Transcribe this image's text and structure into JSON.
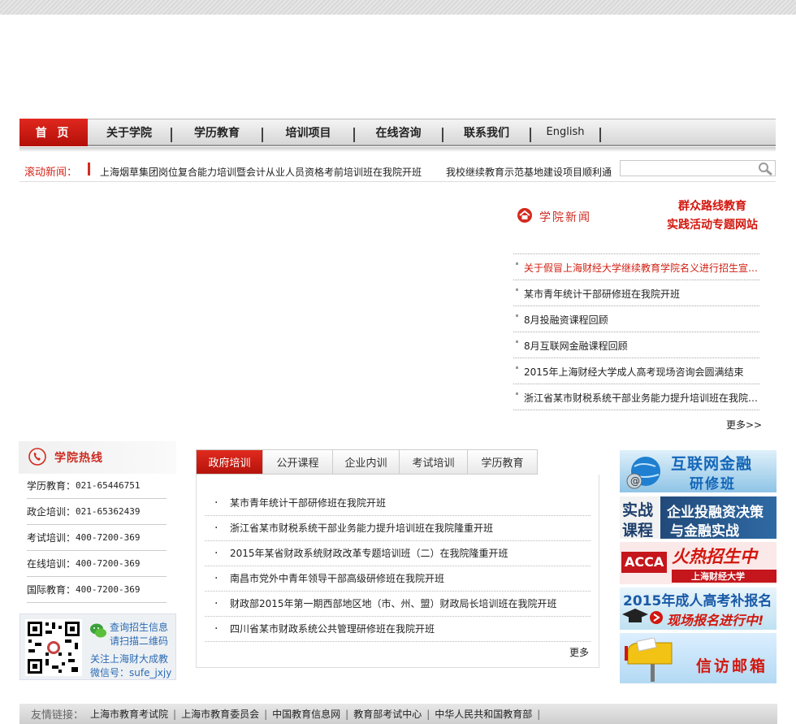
{
  "nav": {
    "items": [
      "首 页",
      "关于学院",
      "学历教育",
      "培训项目",
      "在线咨询",
      "联系我们",
      "English"
    ]
  },
  "ticker": {
    "label": "滚动新闻：",
    "items": [
      "上海烟草集团岗位复合能力培训暨会计从业人员资格考前培训班在我院开班",
      "我校继续教育示范基地建设项目顺利通"
    ]
  },
  "search": {
    "placeholder": ""
  },
  "college_news": {
    "title": "学院新闻",
    "promo": [
      "群众路线教育",
      "实践活动专题网站"
    ],
    "items": [
      "关于假冒上海财经大学继续教育学院名义进行招生宣传的声明",
      "某市青年统计干部研修班在我院开班",
      "8月投融资课程回顾",
      "8月互联网金融课程回顾",
      "2015年上海财经大学成人高考现场咨询会圆满结束",
      "浙江省某市财税系统干部业务能力提升培训班在我院隆重开班"
    ],
    "more": "更多>>"
  },
  "hotline": {
    "title": "学院热线",
    "rows": [
      {
        "label": "学历教育：",
        "number": "021-65446751"
      },
      {
        "label": "政企培训：",
        "number": "021-65362439"
      },
      {
        "label": "考试培训：",
        "number": "400-7200-369"
      },
      {
        "label": "在线培训：",
        "number": "400-7200-369"
      },
      {
        "label": "国际教育：",
        "number": "400-7200-369"
      }
    ],
    "qr_lines": [
      "查询招生信息",
      "请扫描二维码",
      "关注上海财大成教",
      "微信号：sufe_jxjy"
    ]
  },
  "tabs": {
    "items": [
      "政府培训",
      "公开课程",
      "企业内训",
      "考试培训",
      "学历教育"
    ],
    "active": 0,
    "list": [
      "某市青年统计干部研修班在我院开班",
      "浙江省某市财税系统干部业务能力提升培训班在我院隆重开班",
      "2015年某省财政系统财政改革专题培训班（二）在我院隆重开班",
      "南昌市党外中青年领导干部高级研修班在我院开班",
      "财政部2015年第一期西部地区地（市、州、盟）财政局长培训班在我院开班",
      "四川省某市财政系统公共管理研修班在我院开班"
    ],
    "more": "更多"
  },
  "banners": {
    "b1": "互联网金融",
    "b1b": "研修班",
    "b2a": "实战",
    "b2b": "课程",
    "b2c": "企业投融资决策",
    "b2d": "与金融实战",
    "b3a": "ACCA",
    "b3b": "火热招生中",
    "b3c": "上海财经大学",
    "b4a": "2015年成人高考补报名",
    "b4b": "现场报名进行中!",
    "b5": "信访邮箱"
  },
  "footer": {
    "label": "友情链接：",
    "links": [
      "上海市教育考试院",
      "上海市教育委员会",
      "中国教育信息网",
      "教育部考试中心",
      "中华人民共和国教育部"
    ]
  },
  "colors": {
    "accent": "#d42a1f",
    "link_blue": "#2c6bb4"
  }
}
